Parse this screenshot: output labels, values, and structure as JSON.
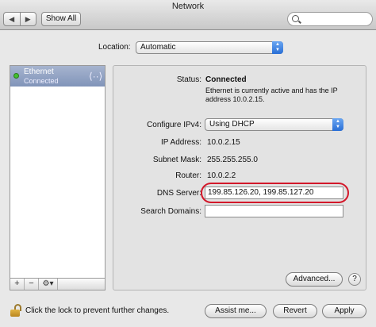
{
  "window": {
    "title": "Network"
  },
  "toolbar": {
    "back_glyph": "◀",
    "forward_glyph": "▶",
    "show_all_label": "Show All",
    "search_value": "",
    "search_icon": "magnifier-icon"
  },
  "location": {
    "label": "Location:",
    "value": "Automatic"
  },
  "sidebar": {
    "items": [
      {
        "name": "Ethernet",
        "status": "Connected",
        "status_color": "#43c02f",
        "icon": "ethernet-icon",
        "icon_glyph": "⟨··⟩"
      }
    ],
    "buttons": {
      "add": "+",
      "remove": "−",
      "gear": "⚙▾"
    }
  },
  "details": {
    "status_label": "Status:",
    "status_value": "Connected",
    "status_desc": "Ethernet is currently active and has the IP address 10.0.2.15.",
    "configure_label": "Configure IPv4:",
    "configure_value": "Using DHCP",
    "ip_label": "IP Address:",
    "ip_value": "10.0.2.15",
    "subnet_label": "Subnet Mask:",
    "subnet_value": "255.255.255.0",
    "router_label": "Router:",
    "router_value": "10.0.2.2",
    "dns_label": "DNS Server:",
    "dns_value": "199.85.126.20, 199.85.127.20",
    "search_domains_label": "Search Domains:",
    "search_domains_value": "",
    "advanced_label": "Advanced...",
    "help_label": "?"
  },
  "footer": {
    "lock_text": "Click the lock to prevent further changes.",
    "assist_label": "Assist me...",
    "revert_label": "Revert",
    "apply_label": "Apply"
  },
  "colors": {
    "highlight_ring": "#d3182a",
    "popup_accent": "#2a6fd6"
  }
}
